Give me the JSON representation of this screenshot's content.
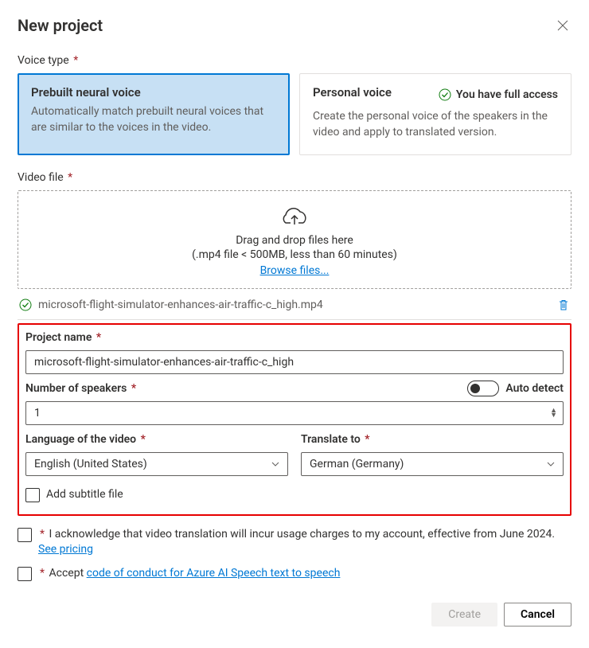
{
  "dialog": {
    "title": "New project"
  },
  "voiceType": {
    "label": "Voice type",
    "prebuilt": {
      "title": "Prebuilt neural voice",
      "description": "Automatically match prebuilt neural voices that are similar to the voices in the video."
    },
    "personal": {
      "title": "Personal voice",
      "access": "You have full access",
      "description": "Create the personal voice of the speakers in the video and apply to translated version."
    }
  },
  "videoFile": {
    "label": "Video file",
    "dropText": "Drag and drop files here",
    "hint": "(.mp4 file < 500MB, less than 60 minutes)",
    "browse": "Browse files...",
    "uploaded": "microsoft-flight-simulator-enhances-air-traffic-c_high.mp4"
  },
  "projectName": {
    "label": "Project name",
    "value": "microsoft-flight-simulator-enhances-air-traffic-c_high"
  },
  "speakers": {
    "label": "Number of speakers",
    "toggleLabel": "Auto detect",
    "value": "1"
  },
  "languageSource": {
    "label": "Language of the video",
    "value": "English (United States)"
  },
  "languageTarget": {
    "label": "Translate to",
    "value": "German (Germany)"
  },
  "subtitle": {
    "label": "Add subtitle file"
  },
  "ack1": {
    "textA": "I acknowledge that video translation will incur usage charges to my account, effective from June 2024. ",
    "link": "See pricing"
  },
  "ack2": {
    "textA": "Accept ",
    "link": "code of conduct for Azure AI Speech text to speech"
  },
  "footer": {
    "create": "Create",
    "cancel": "Cancel"
  }
}
